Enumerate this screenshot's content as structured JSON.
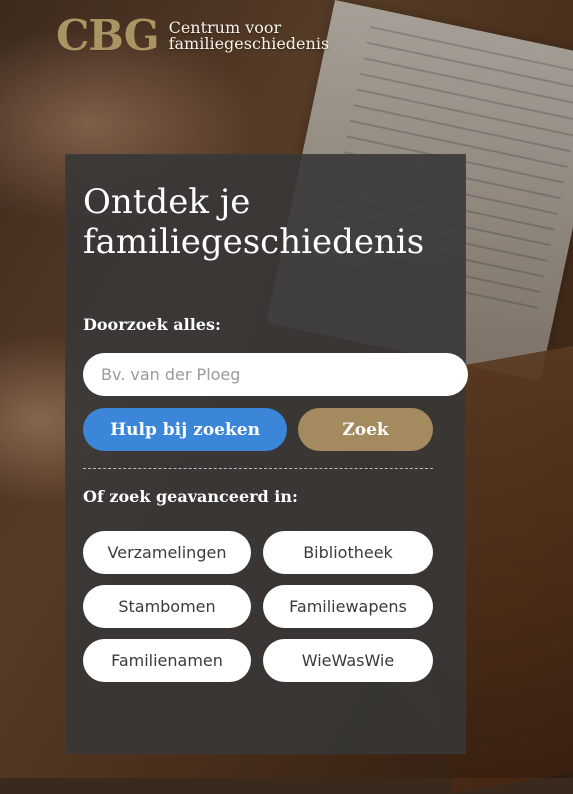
{
  "header": {
    "logo_mark": "CBG",
    "logo_line1": "Centrum voor",
    "logo_line2": "familiegeschiedenis"
  },
  "hero": {
    "title_line1": "Ontdek je",
    "title_line2": "familiegeschiedenis"
  },
  "search": {
    "label": "Doorzoek alles:",
    "placeholder": "Bv. van der Ploeg",
    "value": "",
    "help_button": "Hulp bij zoeken",
    "search_button": "Zoek"
  },
  "advanced": {
    "label": "Of zoek geavanceerd in:",
    "options": [
      "Verzamelingen",
      "Bibliotheek",
      "Stambomen",
      "Familiewapens",
      "Familienamen",
      "WieWasWie"
    ]
  },
  "colors": {
    "accent_gold": "#a48b5f",
    "primary_blue": "#3b86d8",
    "panel_bg": "#373737"
  }
}
